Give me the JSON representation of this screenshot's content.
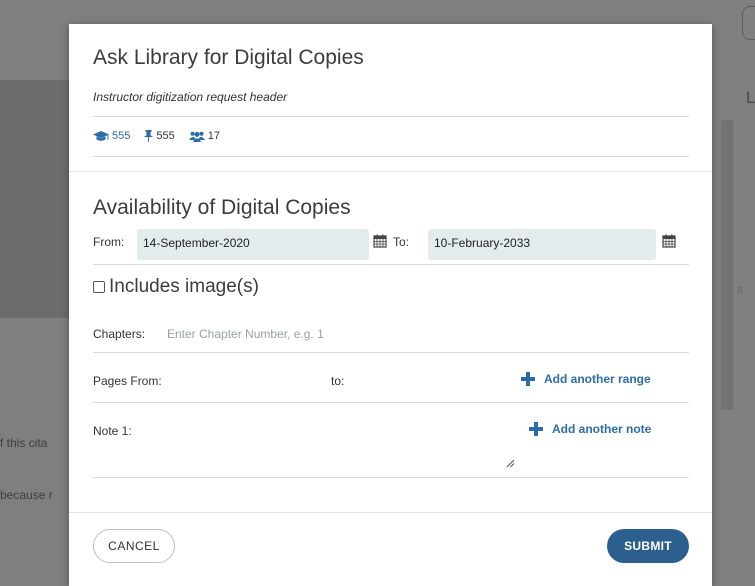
{
  "background": {
    "fragment_1": "f this cita",
    "fragment_2": "because r",
    "letter": "L"
  },
  "modal": {
    "title": "Ask Library for Digital Copies",
    "subtitle": "Instructor digitization request header",
    "stats": [
      {
        "icon": "graduation-cap-icon",
        "value": "555"
      },
      {
        "icon": "thumbtack-icon",
        "value": "555"
      },
      {
        "icon": "users-icon",
        "value": "17"
      }
    ],
    "availability": {
      "title": "Availability of Digital Copies",
      "from_label": "From:",
      "from_value": "14-September-2020",
      "to_label": "To:",
      "to_value": "10-February-2033"
    },
    "includes_images": {
      "label": "Includes image(s)",
      "checked": false
    },
    "chapters": {
      "label": "Chapters:",
      "placeholder": "Enter Chapter Number, e.g. 1"
    },
    "pages": {
      "from_label": "Pages From:",
      "to_label": "to:",
      "add_label": "Add another range"
    },
    "note": {
      "label": "Note 1:",
      "add_label": "Add another note"
    },
    "footer": {
      "cancel_label": "CANCEL",
      "submit_label": "SUBMIT"
    },
    "colors": {
      "accent": "#2a6da8",
      "submit": "#2b5f8e",
      "date_field": "#e3ebec"
    }
  }
}
